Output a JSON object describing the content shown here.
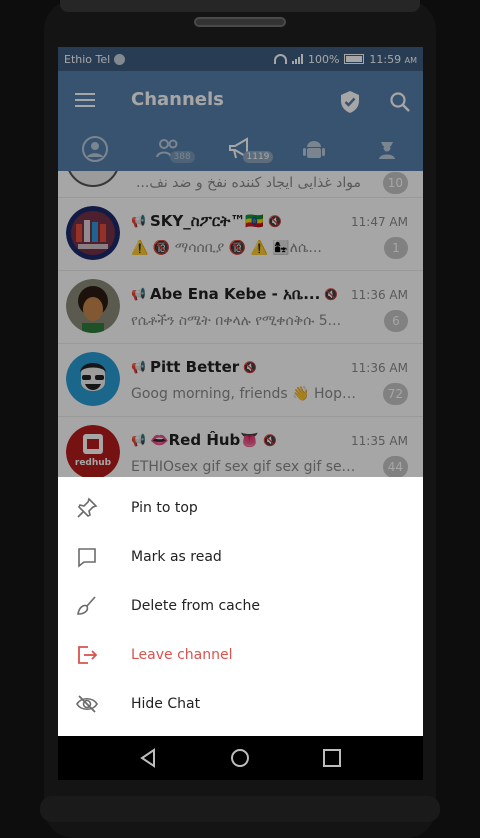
{
  "status_bar": {
    "carrier": "Ethio Tel",
    "battery": "100%",
    "time": "11:59",
    "ampm": "AM"
  },
  "app_bar": {
    "title": "Channels",
    "icons": [
      "menu-icon",
      "shield-check-icon",
      "search-icon"
    ]
  },
  "tabs": [
    {
      "icon": "person-icon",
      "badge": ""
    },
    {
      "icon": "group-icon",
      "badge": "388"
    },
    {
      "icon": "megaphone-icon",
      "badge": "1119"
    },
    {
      "icon": "android-icon",
      "badge": ""
    },
    {
      "icon": "agent-icon",
      "badge": ""
    }
  ],
  "partial_row": {
    "preview": "مواد غذایی ایجاد کننده نفخ و ضد نف...",
    "badge": "10"
  },
  "chats": [
    {
      "name": "SKY_ስፖርት™🇪🇹",
      "time": "11:47 AM",
      "preview": "⚠️ 🔞 ማሳሰቢያ 🔞 ⚠️ 👩‍👧ለሴ...",
      "badge": "1"
    },
    {
      "name": "Abe Ena Kebe - አቤ...",
      "time": "11:36 AM",
      "preview": "የሴቶችን ስሜት በቀላሉ የሚቀሰቅሱ 5...",
      "badge": "6"
    },
    {
      "name": "Pitt Better",
      "time": "11:36 AM",
      "preview": "Goog morning, friends 👋 Hope y...",
      "badge": "72"
    },
    {
      "name": "👄Red Ĥub👅",
      "time": "11:35 AM",
      "preview": "ETHIOsex gif sex gif sex gif sex E...",
      "badge": "44"
    }
  ],
  "avatar_text": {
    "red_hub": "redhub"
  },
  "sheet": {
    "items": [
      {
        "label": "Pin to top",
        "icon": "pin-icon"
      },
      {
        "label": "Mark as read",
        "icon": "chat-bubble-icon"
      },
      {
        "label": "Delete from cache",
        "icon": "broom-icon"
      },
      {
        "label": "Leave channel",
        "icon": "leave-icon"
      },
      {
        "label": "Hide Chat",
        "icon": "eye-off-icon"
      }
    ]
  },
  "colors": {
    "app_bar": "#5780ab",
    "status_bar": "#3e5f81",
    "danger": "#d9534f"
  }
}
